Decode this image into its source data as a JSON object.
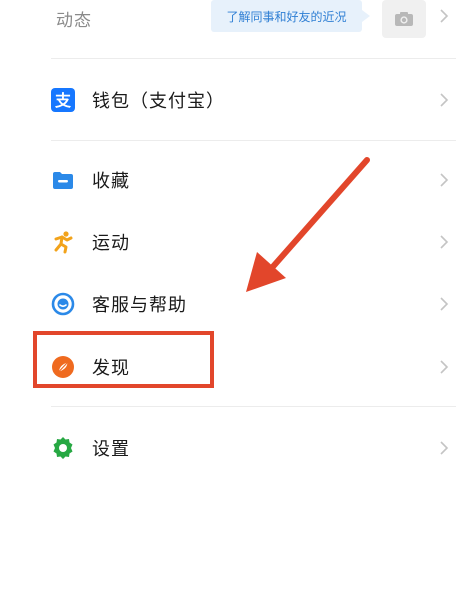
{
  "moments": {
    "label": "动态",
    "hint": "了解同事和好友的近况"
  },
  "menu": {
    "items": [
      {
        "label": "钱包（支付宝）",
        "icon": "alipay-icon"
      },
      {
        "label": "收藏",
        "icon": "folder-icon"
      },
      {
        "label": "运动",
        "icon": "running-icon"
      },
      {
        "label": "客服与帮助",
        "icon": "headset-icon"
      },
      {
        "label": "发现",
        "icon": "compass-icon"
      },
      {
        "label": "设置",
        "icon": "gear-icon"
      }
    ]
  },
  "colors": {
    "alipay": "#1677ff",
    "folder": "#2b89e8",
    "running": "#f2a31b",
    "headset": "#2b89e8",
    "compass": "#ef6a1f",
    "gear": "#27a843",
    "highlight": "#e2462b"
  }
}
